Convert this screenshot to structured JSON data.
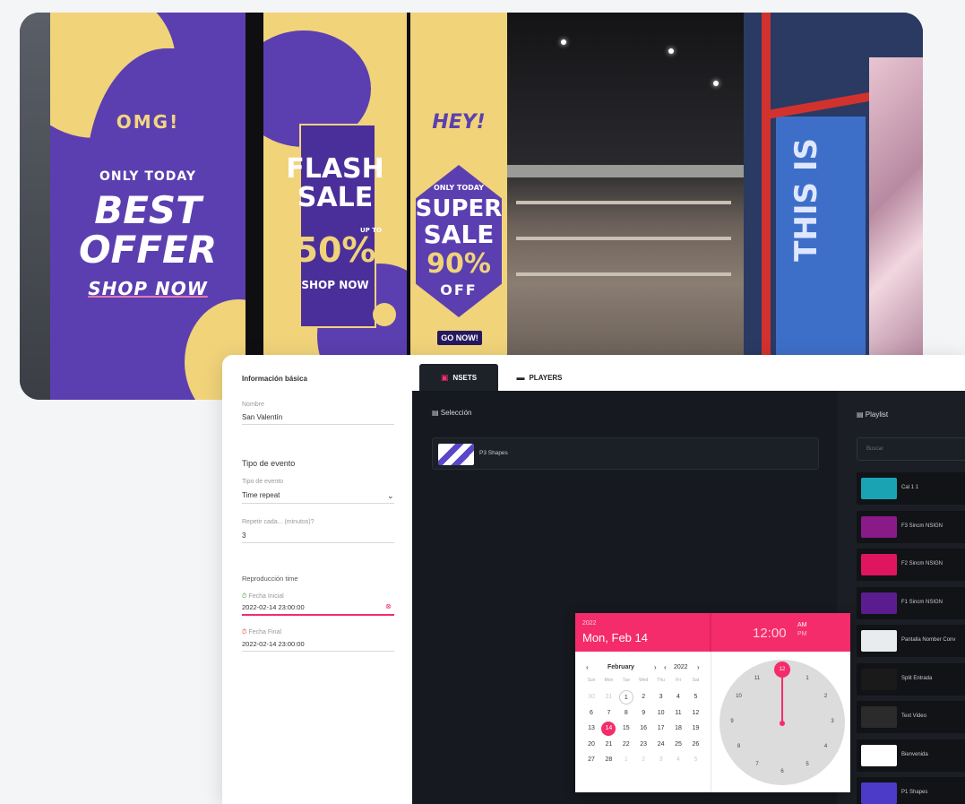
{
  "hero": {
    "poster1": {
      "omg": "OMG!",
      "only_today": "ONLY TODAY",
      "best": "BEST",
      "offer": "OFFER",
      "shop_now": "SHOP NOW"
    },
    "poster2": {
      "flash": "FLASH",
      "sale": "SALE",
      "pct": "50%",
      "upto": "UP TO",
      "shop_now": "SHOP NOW"
    },
    "poster3": {
      "hey": "HEY!",
      "only_today": "ONLY TODAY",
      "super": "SUPER",
      "sale": "SALE",
      "pct": "90%",
      "off": "OFF",
      "go_now": "GO NOW!"
    },
    "wall_text": "THIS IS"
  },
  "form": {
    "section_basic": "Información básica",
    "name_label": "Nombre",
    "name_value": "San Valentín",
    "section_event": "Tipo de evento",
    "event_type_label": "Tipo de evento",
    "event_type_value": "Time repeat",
    "repeat_label": "Repetir cada... (minutos)?",
    "repeat_value": "3",
    "section_repro": "Reproducción time",
    "start_label": "Fecha Inicial",
    "start_value": "2022-02-14 23:00:00",
    "end_label": "Fecha Final",
    "end_value": "2022-02-14 23:00:00"
  },
  "tabs": [
    {
      "label": "NSETS",
      "icon": "nset-icon"
    },
    {
      "label": "PLAYERS",
      "icon": "player-icon"
    }
  ],
  "seleccion": {
    "title": "Selección",
    "items": [
      {
        "name": "P3 Shapes"
      }
    ]
  },
  "playlist": {
    "title": "Playlist",
    "search_placeholder": "Buscar",
    "items": [
      {
        "name": "Cal 1 1",
        "color": "#1aa3b3"
      },
      {
        "name": "F3 Sincm NSIGN",
        "color": "#8a1a88"
      },
      {
        "name": "F2 Sincm NSIGN",
        "color": "#e0155f"
      },
      {
        "name": "F1 Sincm NSIGN",
        "color": "#5b1c8f"
      },
      {
        "name": "Pantalla Nomber Conv",
        "color": "#e8ecef"
      },
      {
        "name": "Split Entrada",
        "color": "#1a1a1a"
      },
      {
        "name": "Text Video",
        "color": "#2b2b2b"
      },
      {
        "name": "Bienvenida",
        "color": "#ffffff"
      },
      {
        "name": "P1 Shapes",
        "color": "#4b3bc8"
      }
    ]
  },
  "picker": {
    "year": "2022",
    "date": "Mon, Feb 14",
    "time": "12:00",
    "am": "AM",
    "pm": "PM",
    "month": "February",
    "year_nav": "2022",
    "dow": [
      "Sun",
      "Mon",
      "Tue",
      "Wed",
      "Thu",
      "Fri",
      "Sat"
    ],
    "weeks": [
      [
        "30",
        "31",
        "1",
        "2",
        "3",
        "4",
        "5"
      ],
      [
        "6",
        "7",
        "8",
        "9",
        "10",
        "11",
        "12"
      ],
      [
        "13",
        "14",
        "15",
        "16",
        "17",
        "18",
        "19"
      ],
      [
        "20",
        "21",
        "22",
        "23",
        "24",
        "25",
        "26"
      ],
      [
        "27",
        "28",
        "1",
        "2",
        "3",
        "4",
        "5"
      ]
    ],
    "selected_day": "14",
    "clock_numbers": [
      "12",
      "1",
      "2",
      "3",
      "4",
      "5",
      "6",
      "7",
      "8",
      "9",
      "10",
      "11"
    ],
    "selected_hour": "12"
  },
  "colors": {
    "accent": "#f42c6b",
    "dark_bg": "#16191f"
  }
}
